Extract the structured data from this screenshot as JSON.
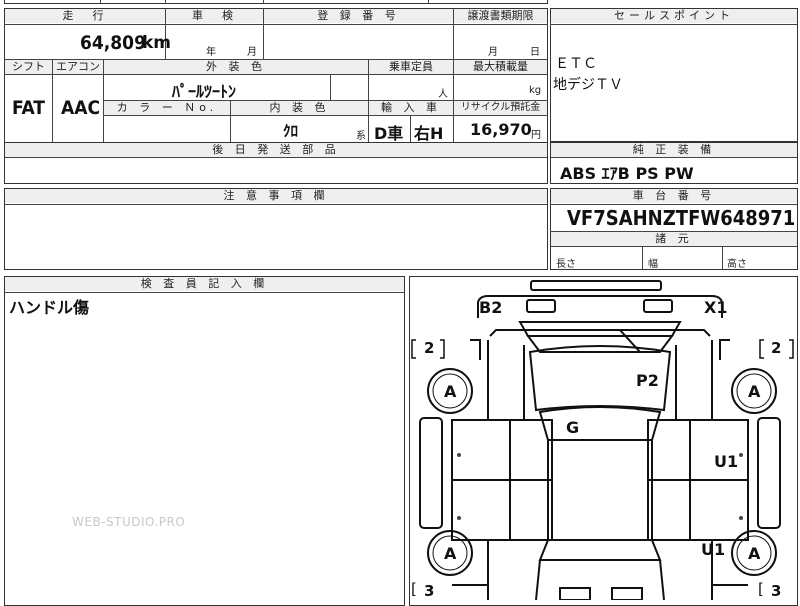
{
  "top_cut": {
    "text1": "ⅢⅡⅡ",
    "text2": "ⅰ"
  },
  "headers": {
    "mileage": "走　行",
    "inspection": "車　検",
    "registration": "登 録 番 号",
    "transfer_deadline": "譲渡書類期限",
    "sales_point": "セールスポイント",
    "shift": "シフト",
    "aircon": "エアコン",
    "exterior_color": "外 装 色",
    "capacity": "乗車定員",
    "max_load": "最大積載量",
    "color_no": "カ ラ ー Ｎo.",
    "interior_color": "内 装 色",
    "import": "輸 入 車",
    "recycle": "リサイクル預託金",
    "later_parts": "後 日 発 送 部 品",
    "standard_equipment": "純 正 装 備",
    "notes": "注 意 事 項 欄",
    "vin": "車 台 番 号",
    "inspector": "検 査 員 記 入 欄",
    "dimensions": "諸 元"
  },
  "values": {
    "mileage_value": "64,809",
    "mileage_unit": "km",
    "inspection_year": "年",
    "inspection_month": "月",
    "transfer_month": "月",
    "transfer_day": "日",
    "sales_point_1": "ＥＴＣ",
    "sales_point_2": "地デジＴＶ",
    "shift": "FAT",
    "aircon": "AAC",
    "exterior_color": "ﾊﾟｰﾙﾂｰﾄﾝ",
    "capacity_unit": "人",
    "load_unit": "kg",
    "interior_color": "ｸﾛ",
    "interior_suffix": "系",
    "import_type": "D車",
    "handle": "右H",
    "recycle_value": "16,970",
    "recycle_unit": "円",
    "standard_equipment": "ABS ｴｱB PS PW",
    "vin": "VF7SAHNZTFW648971",
    "length_label": "長さ",
    "width_label": "幅",
    "height_label": "高さ",
    "inspector_note": "ハンドル傷"
  },
  "diagram": {
    "marks": [
      "B2",
      "X1",
      "P2",
      "G",
      "U1",
      "U1"
    ],
    "tire_label": "A",
    "bracket_front": "2",
    "bracket_rear": "3"
  },
  "watermark": "WEB-STUDIO.PRO"
}
